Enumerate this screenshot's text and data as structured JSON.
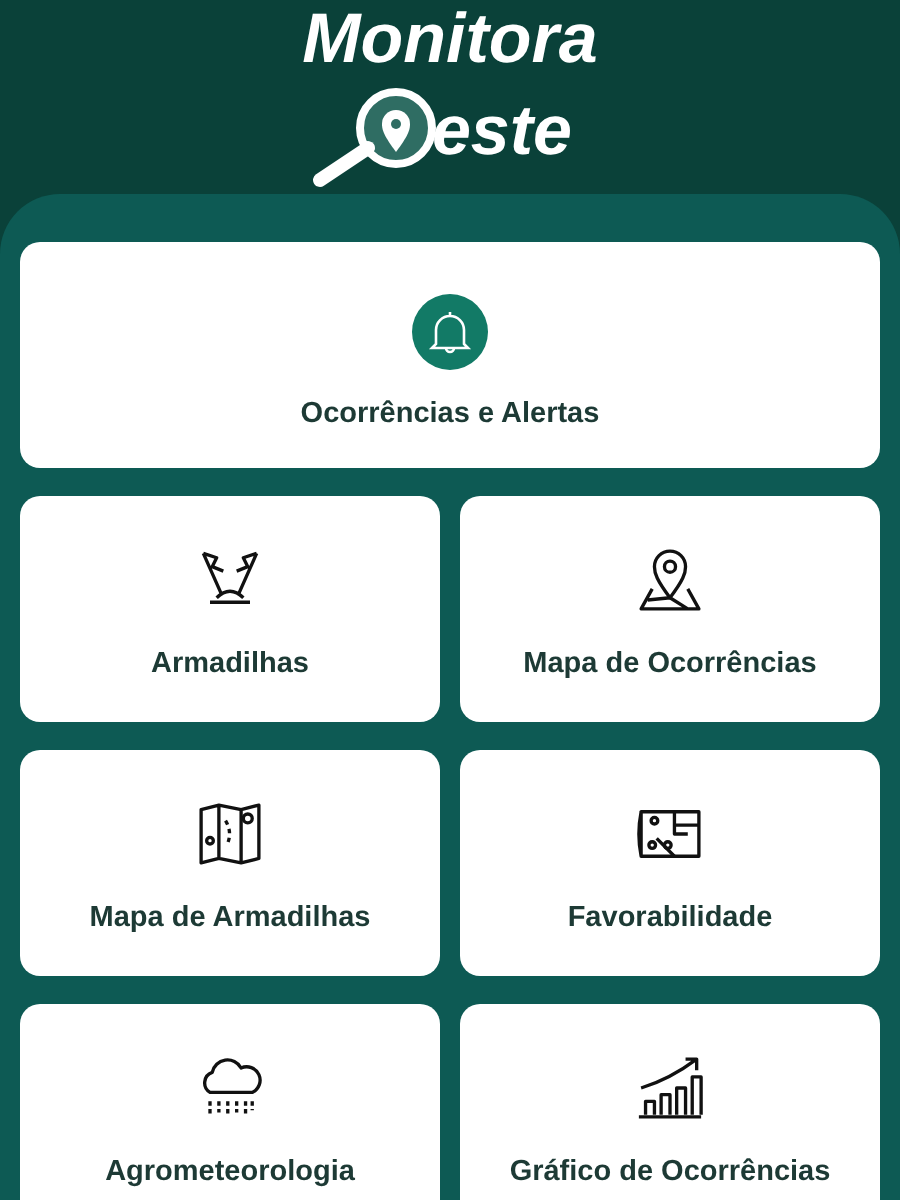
{
  "header": {
    "title": "Monitora",
    "title_end": "este"
  },
  "featured": {
    "label": "Ocorrências e Alertas"
  },
  "tiles": [
    {
      "label": "Armadilhas"
    },
    {
      "label": "Mapa de Ocorrências"
    },
    {
      "label": "Mapa de Armadilhas"
    },
    {
      "label": "Favorabilidade"
    },
    {
      "label": "Agrometeorologia"
    },
    {
      "label": "Gráfico de Ocorrências"
    }
  ]
}
